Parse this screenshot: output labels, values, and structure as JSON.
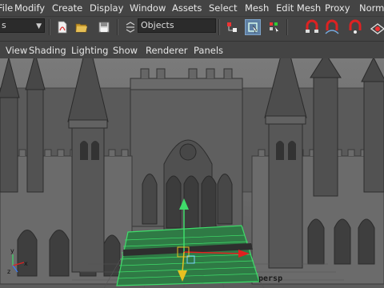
{
  "menu": {
    "items": [
      "File",
      "Modify",
      "Create",
      "Display",
      "Window",
      "Assets",
      "Select",
      "Mesh",
      "Edit Mesh",
      "Proxy",
      "Normals"
    ]
  },
  "status_line": {
    "mode_value": "s",
    "selection_mask_value": "Objects"
  },
  "panel_menu": {
    "items": [
      "View",
      "Shading",
      "Lighting",
      "Show",
      "Renderer",
      "Panels"
    ]
  },
  "viewport": {
    "camera_label": "persp"
  },
  "colors": {
    "menu_bg": "#444444",
    "active_button": "#5e7fa3",
    "selection_green": "#3fdc6a",
    "manipulator_red": "#e02020",
    "manipulator_yellow": "#e8c020"
  },
  "icons": [
    "new-scene-icon",
    "open-scene-icon",
    "save-scene-icon",
    "selection-mask-icon",
    "select-by-hierarchy-icon",
    "select-by-object-icon",
    "select-by-component-icon",
    "snap-to-grid-icon",
    "snap-to-curve-icon",
    "snap-to-point-icon",
    "snap-to-plane-icon"
  ]
}
